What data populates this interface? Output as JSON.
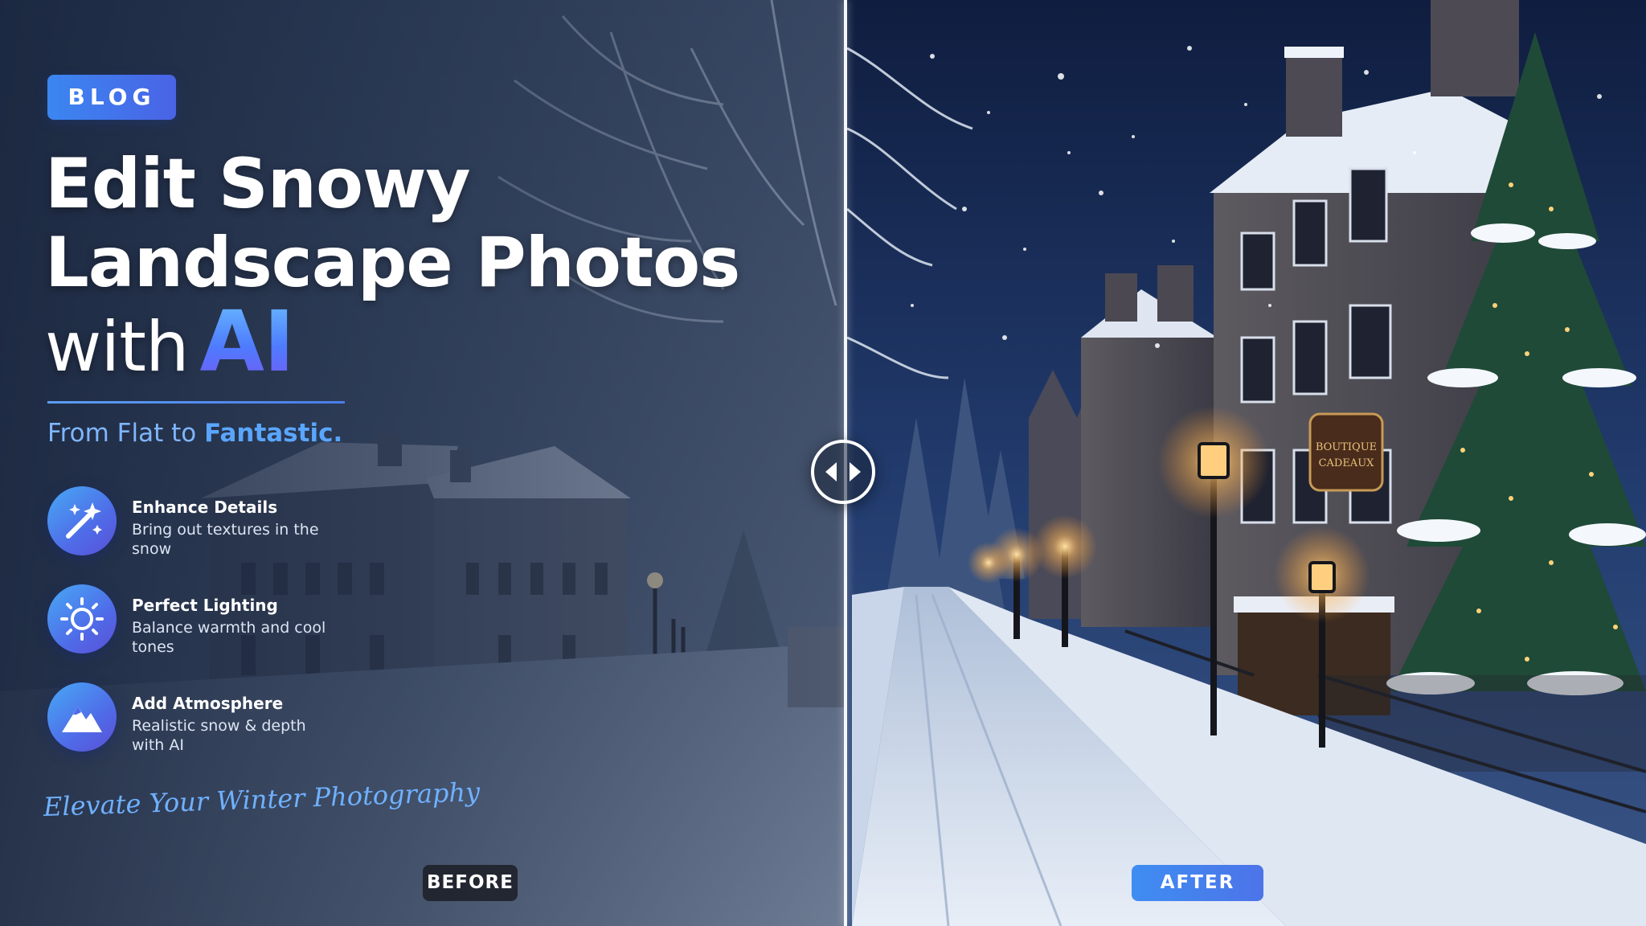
{
  "badge": {
    "label": "BLOG"
  },
  "headline": {
    "line1": "Edit Snowy",
    "line2": "Landscape Photos",
    "line3_prefix": "with",
    "line3_highlight": "AI"
  },
  "tagline": {
    "prefix": "From Flat to ",
    "highlight": "Fantastic."
  },
  "features": [
    {
      "icon": "magic-wand-sparkles-icon",
      "title": "Enhance Details",
      "description": "Bring out textures in the snow"
    },
    {
      "icon": "sun-icon",
      "title": "Perfect Lighting",
      "description": "Balance warmth and cool tones"
    },
    {
      "icon": "mountain-icon",
      "title": "Add Atmosphere",
      "description": "Realistic snow & depth with AI"
    }
  ],
  "script_line": "Elevate Your Winter Photography",
  "comparison": {
    "before_label": "BEFORE",
    "after_label": "AFTER",
    "handle_icon": "left-right-arrows-icon"
  },
  "signage": {
    "shop_line1": "BOUTIQUE",
    "shop_line2": "CADEAUX"
  },
  "colors": {
    "accent_blue": "#3f8df2",
    "accent_purple": "#5b4fd6",
    "tagline_blue": "#7fb6ff",
    "lamp_glow": "#ffc978",
    "night_sky": "#1a2d55"
  }
}
